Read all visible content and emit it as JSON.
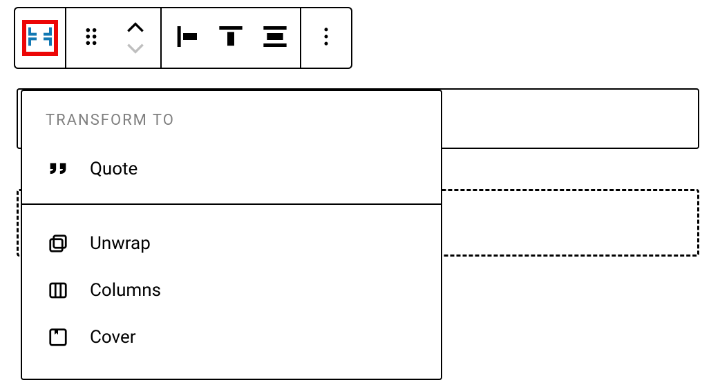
{
  "toolbar": {
    "block_type_icon": "row-block",
    "drag_icon": "drag-handle",
    "move_up_icon": "chevron-up",
    "move_down_icon": "chevron-down",
    "align_horiz_icon": "justify-left",
    "valign_top_icon": "align-top",
    "valign_stretch_icon": "align-stretch",
    "more_icon": "more-vertical"
  },
  "popover": {
    "header": "TRANSFORM TO",
    "primary": [
      {
        "icon": "quote",
        "label": "Quote"
      }
    ],
    "secondary": [
      {
        "icon": "unwrap",
        "label": "Unwrap"
      },
      {
        "icon": "columns",
        "label": "Columns"
      },
      {
        "icon": "cover",
        "label": "Cover"
      }
    ]
  }
}
